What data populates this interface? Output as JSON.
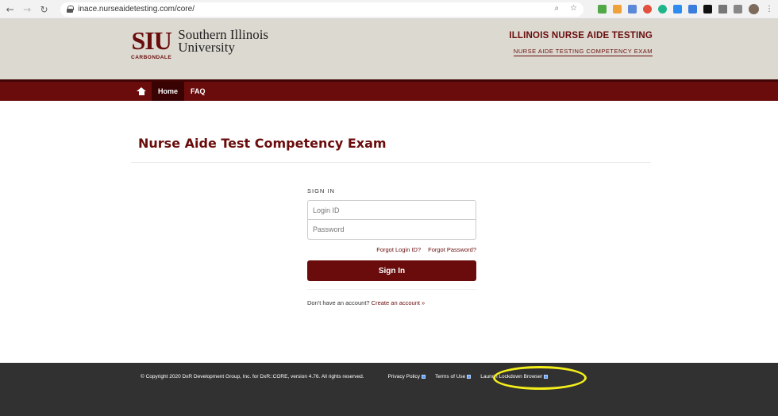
{
  "browser": {
    "url": "inace.nurseaidetesting.com/core/",
    "back_icon": "←",
    "forward_icon": "→",
    "reload_icon": "↻",
    "zoom_icon": "⌕",
    "star_icon": "☆",
    "menu_icon": "⋮"
  },
  "header": {
    "logo_mark": "SIU",
    "logo_campus": "CARBONDALE",
    "logo_name_line1": "Southern Illinois",
    "logo_name_line2": "University",
    "title": "ILLINOIS NURSE AIDE TESTING",
    "subtitle": "NURSE AIDE TESTING COMPETENCY EXAM"
  },
  "nav": {
    "items": [
      {
        "label": "Home",
        "active": true
      },
      {
        "label": "FAQ",
        "active": false
      }
    ]
  },
  "main": {
    "page_title": "Nurse Aide Test Competency Exam",
    "signin": {
      "label": "SIGN IN",
      "login_placeholder": "Login ID",
      "password_placeholder": "Password",
      "forgot_login": "Forgot Login ID?",
      "forgot_password": "Forgot Password?",
      "button": "Sign In",
      "no_account": "Don't have an account?",
      "create_account": "Create an account »"
    }
  },
  "footer": {
    "copyright": "© Copyright 2020 DxR Development Group, Inc. for DxR::CORE, version 4.76. All rights reserved.",
    "privacy": "Privacy Policy",
    "terms": "Terms of Use",
    "lockdown": "Launch Lockdown Browser"
  },
  "colors": {
    "brand": "#6a0c0c",
    "header_bg": "#dcd9d1",
    "footer_bg": "#313131",
    "highlight": "#f4ef1a"
  }
}
